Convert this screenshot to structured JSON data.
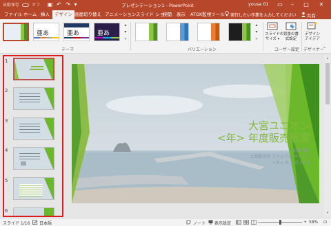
{
  "titlebar": {
    "autosave_label": "自動保存",
    "autosave_state": "オフ",
    "doc_title": "プレゼンテーション1 - PowerPoint",
    "user_name": "yousa 01",
    "save_icon": "save-icon",
    "undo_icon": "undo-icon",
    "redo_icon": "redo-icon",
    "customize_icon": "customize-qat-icon",
    "ribbon_display_icon": "ribbon-display-icon",
    "minimize_icon": "minimize-icon",
    "maximize_icon": "maximize-icon",
    "close_icon": "close-icon",
    "minimize_glyph": "–",
    "maximize_glyph": "□",
    "close_glyph": "✕",
    "ribbon_display_glyph": "▭",
    "customize_glyph": "▾",
    "save_glyph": "▣",
    "undo_glyph": "↶",
    "redo_glyph": "↷"
  },
  "tabs": {
    "items": [
      "ファイル",
      "ホーム",
      "挿入",
      "デザイン",
      "画面切り替え",
      "アニメーション",
      "スライド ショー",
      "校閲",
      "表示",
      "ATOK監視ツール"
    ],
    "active": "デザイン",
    "tell_me": "実行したい作業を入力してください",
    "share": "共有"
  },
  "ribbon": {
    "themes_group_label": "テーマ",
    "theme_thumb_text": [
      "",
      "亜あ",
      "亜あ",
      "亜あ"
    ],
    "variations_group_label": "バリエーション",
    "user_settings_group_label": "ユーザー設定",
    "designer_group_label": "デザイナー",
    "slide_size_label": "スライドの\nサイズ ▾",
    "background_label": "背景の書\n式設定",
    "design_ideas_label": "デザイン\nアイデア",
    "gallery_up": "▴",
    "gallery_down": "▾",
    "gallery_more": "▿",
    "collapse_glyph": "^"
  },
  "thumbnails": {
    "numbers": [
      "1",
      "2",
      "3",
      "4",
      "5",
      "6"
    ],
    "selected": "1"
  },
  "slide": {
    "title_line1": "大宮ユニオン",
    "title_line2": "<年> 年度販売提案",
    "presenter": "加藤 瑠紀",
    "company": "上岡製作所 ファルワバ サービス",
    "date": "<年> 年 3 月 24 日"
  },
  "statusbar": {
    "slide_count": "スライド 1/16",
    "language": "日本語",
    "notes": "ノート",
    "display_settings": "表示設定",
    "zoom": "58%",
    "zoom_minus": "−",
    "zoom_plus": "+",
    "fit_glyph": "⊡"
  },
  "colors": {
    "accent": "#b7472a",
    "slide_green": "#86b83b",
    "highlight_frame": "#e01b1b"
  }
}
